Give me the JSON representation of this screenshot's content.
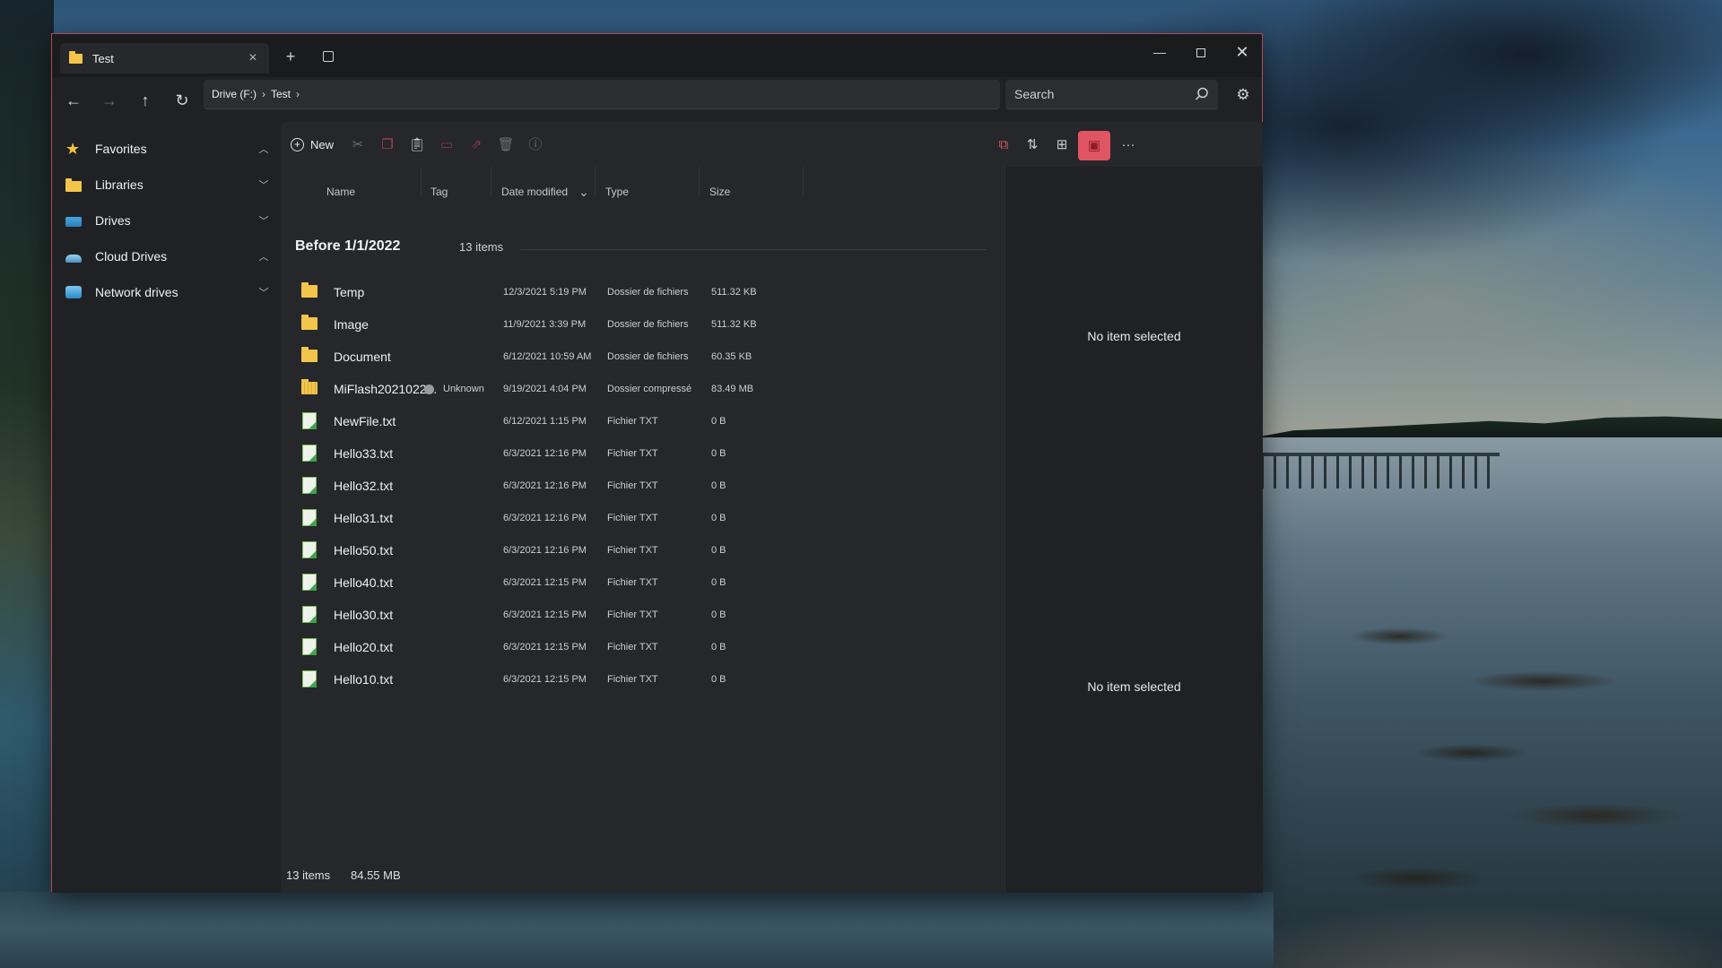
{
  "window": {
    "tab_title": "Test",
    "tab_close_glyph": "×",
    "new_tab_glyph": "+",
    "min_glyph": "—",
    "close_glyph": "✕"
  },
  "nav": {
    "back_glyph": "←",
    "forward_glyph": "→",
    "up_glyph": "↑",
    "refresh_glyph": "↻",
    "breadcrumbs": [
      "Drive (F:)",
      "Test"
    ],
    "search_placeholder": "Search",
    "settings_glyph": "⚙"
  },
  "sidebar": {
    "items": [
      {
        "label": "Favorites",
        "icon": "star-icon",
        "chevron": "^"
      },
      {
        "label": "Libraries",
        "icon": "folder-icon",
        "chevron": "v"
      },
      {
        "label": "Drives",
        "icon": "drive-icon",
        "chevron": "v"
      },
      {
        "label": "Cloud Drives",
        "icon": "cloud-icon",
        "chevron": "^"
      },
      {
        "label": "Network drives",
        "icon": "network-icon",
        "chevron": "v"
      }
    ]
  },
  "toolbar": {
    "new_label": "New",
    "more_glyph": "···"
  },
  "columns": {
    "name": "Name",
    "tag": "Tag",
    "date": "Date modified",
    "type": "Type",
    "size": "Size",
    "sort_glyph": "⌄"
  },
  "group": {
    "title": "Before 1/1/2022",
    "count": "13 items"
  },
  "files": [
    {
      "name": "Temp",
      "tag": "",
      "date": "12/3/2021 5:19 PM",
      "type": "Dossier de fichiers",
      "size": "511.32 KB",
      "kind": "folder"
    },
    {
      "name": "Image",
      "tag": "",
      "date": "11/9/2021 3:39 PM",
      "type": "Dossier de fichiers",
      "size": "511.32 KB",
      "kind": "folder"
    },
    {
      "name": "Document",
      "tag": "",
      "date": "6/12/2021 10:59 AM",
      "type": "Dossier de fichiers",
      "size": "60.35 KB",
      "kind": "folder"
    },
    {
      "name": "MiFlash2021022...",
      "tag": "Unknown",
      "date": "9/19/2021 4:04 PM",
      "type": "Dossier compressé",
      "size": "83.49 MB",
      "kind": "zip"
    },
    {
      "name": "NewFile.txt",
      "tag": "",
      "date": "6/12/2021 1:15 PM",
      "type": "Fichier TXT",
      "size": "0 B",
      "kind": "txt"
    },
    {
      "name": "Hello33.txt",
      "tag": "",
      "date": "6/3/2021 12:16 PM",
      "type": "Fichier TXT",
      "size": "0 B",
      "kind": "txt"
    },
    {
      "name": "Hello32.txt",
      "tag": "",
      "date": "6/3/2021 12:16 PM",
      "type": "Fichier TXT",
      "size": "0 B",
      "kind": "txt"
    },
    {
      "name": "Hello31.txt",
      "tag": "",
      "date": "6/3/2021 12:16 PM",
      "type": "Fichier TXT",
      "size": "0 B",
      "kind": "txt"
    },
    {
      "name": "Hello50.txt",
      "tag": "",
      "date": "6/3/2021 12:16 PM",
      "type": "Fichier TXT",
      "size": "0 B",
      "kind": "txt"
    },
    {
      "name": "Hello40.txt",
      "tag": "",
      "date": "6/3/2021 12:15 PM",
      "type": "Fichier TXT",
      "size": "0 B",
      "kind": "txt"
    },
    {
      "name": "Hello30.txt",
      "tag": "",
      "date": "6/3/2021 12:15 PM",
      "type": "Fichier TXT",
      "size": "0 B",
      "kind": "txt"
    },
    {
      "name": "Hello20.txt",
      "tag": "",
      "date": "6/3/2021 12:15 PM",
      "type": "Fichier TXT",
      "size": "0 B",
      "kind": "txt"
    },
    {
      "name": "Hello10.txt",
      "tag": "",
      "date": "6/3/2021 12:15 PM",
      "type": "Fichier TXT",
      "size": "0 B",
      "kind": "txt"
    }
  ],
  "preview": {
    "message_top": "No item selected",
    "message_bottom": "No item selected"
  },
  "status": {
    "item_count": "13 items",
    "total_size": "84.55 MB"
  },
  "colors": {
    "accent": "#e05563",
    "window_border": "#b24a52",
    "folder": "#f3c54a"
  }
}
